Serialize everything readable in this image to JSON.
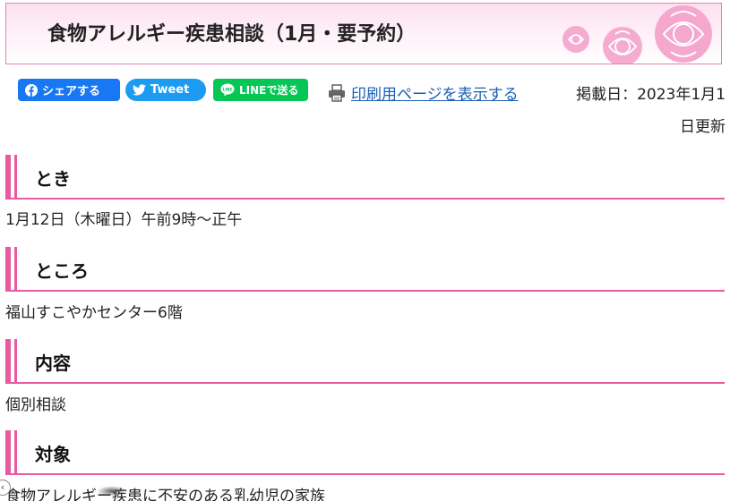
{
  "header": {
    "title": "食物アレルギー疾患相談（1月・要予約）"
  },
  "share": {
    "facebook_label": "シェアする",
    "twitter_label": "Tweet",
    "line_label": "LINEで送る"
  },
  "print": {
    "label": "印刷用ページを表示する"
  },
  "published": {
    "line1": "掲載日：2023年1月1",
    "line2": "日更新"
  },
  "sections": [
    {
      "heading": "とき",
      "body": "1月12日（木曜日）午前9時～正午"
    },
    {
      "heading": "ところ",
      "body": "福山すこやかセンター6階"
    },
    {
      "heading": "内容",
      "body": "個別相談"
    },
    {
      "heading": "対象",
      "body": "食物アレルギー疾患に不安のある乳幼児の家族"
    }
  ],
  "colors": {
    "accent": "#e85aa2",
    "facebook": "#1877f2",
    "twitter": "#1d9bf0",
    "line": "#06c755",
    "link": "#1a5fb4"
  }
}
